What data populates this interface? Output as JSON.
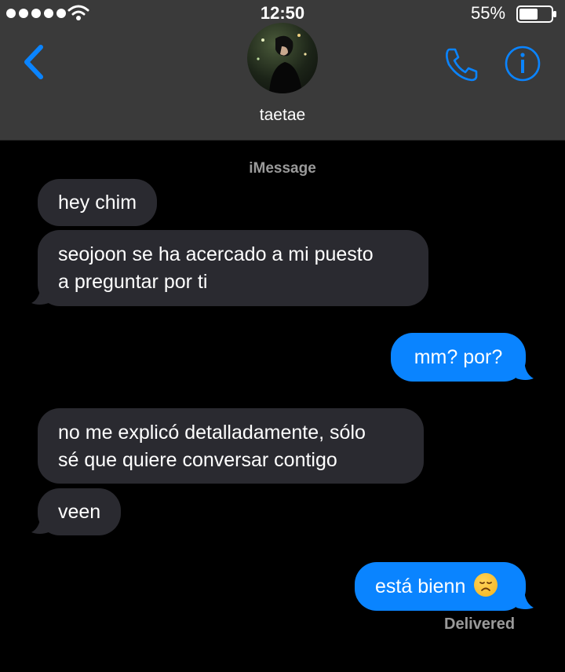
{
  "status_bar": {
    "time": "12:50",
    "battery": "55%"
  },
  "contact": {
    "name": "taetae"
  },
  "thread": {
    "service": "iMessage",
    "messages": [
      {
        "side": "in",
        "text": "hey chim"
      },
      {
        "side": "in",
        "lines": [
          "seojoon se ha acercado a mi puesto",
          "a preguntar por ti"
        ]
      },
      {
        "side": "out",
        "text": "mm? por?"
      },
      {
        "side": "in",
        "lines": [
          "no me explicó detalladamente, sólo",
          "sé que quiere conversar contigo"
        ]
      },
      {
        "side": "in",
        "text": "veen"
      },
      {
        "side": "out",
        "text": "está bienn",
        "emoji": "disappointed-face"
      }
    ],
    "delivery_status": "Delivered"
  },
  "colors": {
    "accent": "#0a84ff",
    "incoming": "#2a2a30",
    "header": "#3a3a3a"
  },
  "icons": [
    "back-chevron-icon",
    "phone-icon",
    "info-icon",
    "wifi-icon",
    "battery-icon"
  ]
}
